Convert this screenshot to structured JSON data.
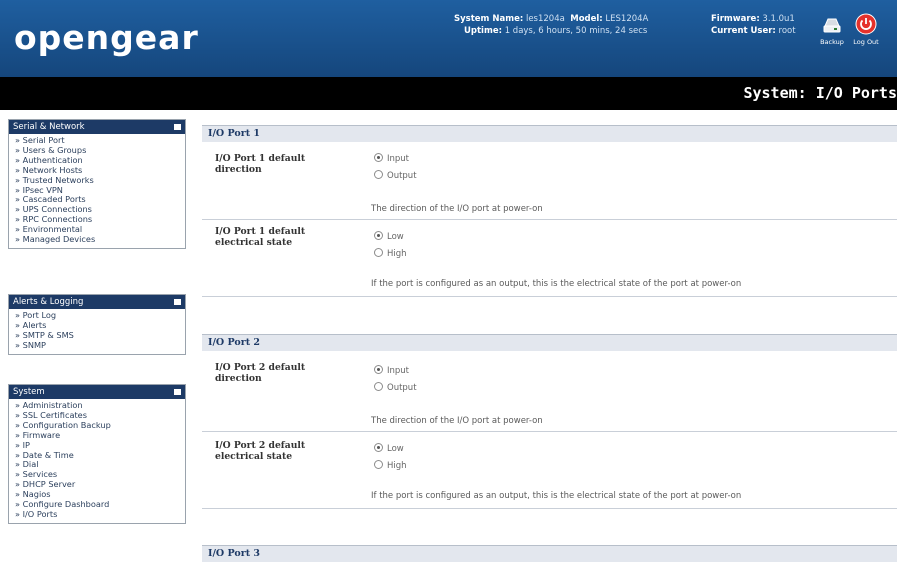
{
  "header": {
    "logo": "opengear",
    "system_name_label": "System Name:",
    "system_name": "les1204a",
    "model_label": "Model:",
    "model": "LES1204A",
    "firmware_label": "Firmware:",
    "firmware": "3.1.0u1",
    "uptime_label": "Uptime:",
    "uptime": "1 days, 6 hours, 50 mins, 24 secs",
    "current_user_label": "Current User:",
    "current_user": "root",
    "backup_label": "Backup",
    "logout_label": "Log Out"
  },
  "page_title": "System: I/O Ports",
  "sidebar": {
    "serial_network": {
      "title": "Serial & Network",
      "items": [
        "Serial Port",
        "Users & Groups",
        "Authentication",
        "Network Hosts",
        "Trusted Networks",
        "IPsec VPN",
        "Cascaded Ports",
        "UPS Connections",
        "RPC Connections",
        "Environmental",
        "Managed Devices"
      ]
    },
    "alerts_logging": {
      "title": "Alerts & Logging",
      "items": [
        "Port Log",
        "Alerts",
        "SMTP & SMS",
        "SNMP"
      ]
    },
    "system": {
      "title": "System",
      "items": [
        "Administration",
        "SSL Certificates",
        "Configuration Backup",
        "Firmware",
        "IP",
        "Date & Time",
        "Dial",
        "Services",
        "DHCP Server",
        "Nagios",
        "Configure Dashboard",
        "I/O Ports"
      ]
    }
  },
  "ports": [
    {
      "title": "I/O Port 1",
      "direction_label": "I/O Port 1 default direction",
      "direction_options": [
        "Input",
        "Output"
      ],
      "direction_selected": "Input",
      "direction_help": "The direction of the I/O port at power-on",
      "state_label": "I/O Port 1 default electrical state",
      "state_options": [
        "Low",
        "High"
      ],
      "state_selected": "Low",
      "state_help": "If the port is configured as an output, this is the electrical state of the port at power-on"
    },
    {
      "title": "I/O Port 2",
      "direction_label": "I/O Port 2 default direction",
      "direction_options": [
        "Input",
        "Output"
      ],
      "direction_selected": "Input",
      "direction_help": "The direction of the I/O port at power-on",
      "state_label": "I/O Port 2 default electrical state",
      "state_options": [
        "Low",
        "High"
      ],
      "state_selected": "Low",
      "state_help": "If the port is configured as an output, this is the electrical state of the port at power-on"
    },
    {
      "title": "I/O Port 3"
    }
  ],
  "colors": {
    "header_blue": "#1a5290",
    "title_bar": "#000000",
    "section_bar": "#e3e7ee",
    "panel_head": "#1d3a66",
    "logout_red": "#e5312b"
  }
}
